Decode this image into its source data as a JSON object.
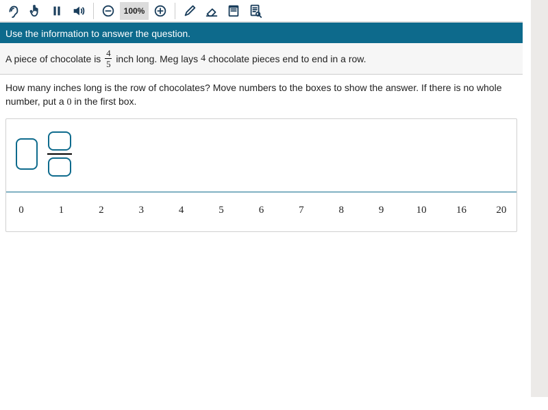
{
  "toolbar": {
    "zoom": "100%"
  },
  "banner": "Use the information to answer the question.",
  "problem": {
    "p1": "A piece of chocolate is",
    "frac_num": "4",
    "frac_den": "5",
    "p2": "inch long. Meg lays",
    "count": "4",
    "p3": "chocolate pieces end to end in a row."
  },
  "question": {
    "q1": "How many inches long is the row of chocolates? Move numbers to the boxes to show the answer. If there is no whole number, put a",
    "zero": "0",
    "q2": "in the first box."
  },
  "numbers": [
    "0",
    "1",
    "2",
    "3",
    "4",
    "5",
    "6",
    "7",
    "8",
    "9",
    "10",
    "16",
    "20"
  ]
}
